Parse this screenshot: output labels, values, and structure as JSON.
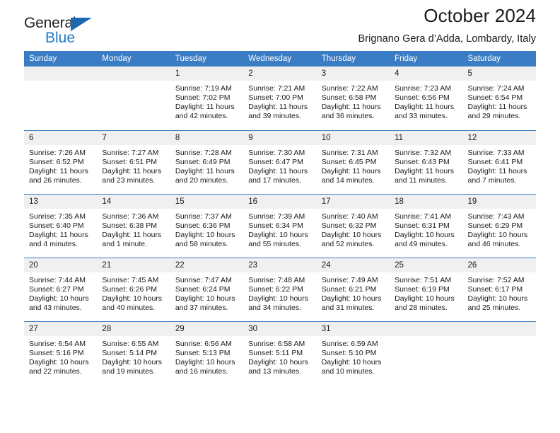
{
  "brand": {
    "name_part1": "General",
    "name_part2": "Blue"
  },
  "header": {
    "title": "October 2024",
    "subtitle": "Brignano Gera d’Adda, Lombardy, Italy"
  },
  "colors": {
    "header_blue": "#3b7dc4",
    "logo_blue": "#1e7ac8",
    "daynum_bg": "#f0f0f0",
    "text": "#1a1a1a"
  },
  "weekday_headers": [
    "Sunday",
    "Monday",
    "Tuesday",
    "Wednesday",
    "Thursday",
    "Friday",
    "Saturday"
  ],
  "weeks": [
    [
      {
        "day": "",
        "lines": []
      },
      {
        "day": "",
        "lines": []
      },
      {
        "day": "1",
        "lines": [
          "Sunrise: 7:19 AM",
          "Sunset: 7:02 PM",
          "Daylight: 11 hours",
          "and 42 minutes."
        ]
      },
      {
        "day": "2",
        "lines": [
          "Sunrise: 7:21 AM",
          "Sunset: 7:00 PM",
          "Daylight: 11 hours",
          "and 39 minutes."
        ]
      },
      {
        "day": "3",
        "lines": [
          "Sunrise: 7:22 AM",
          "Sunset: 6:58 PM",
          "Daylight: 11 hours",
          "and 36 minutes."
        ]
      },
      {
        "day": "4",
        "lines": [
          "Sunrise: 7:23 AM",
          "Sunset: 6:56 PM",
          "Daylight: 11 hours",
          "and 33 minutes."
        ]
      },
      {
        "day": "5",
        "lines": [
          "Sunrise: 7:24 AM",
          "Sunset: 6:54 PM",
          "Daylight: 11 hours",
          "and 29 minutes."
        ]
      }
    ],
    [
      {
        "day": "6",
        "lines": [
          "Sunrise: 7:26 AM",
          "Sunset: 6:52 PM",
          "Daylight: 11 hours",
          "and 26 minutes."
        ]
      },
      {
        "day": "7",
        "lines": [
          "Sunrise: 7:27 AM",
          "Sunset: 6:51 PM",
          "Daylight: 11 hours",
          "and 23 minutes."
        ]
      },
      {
        "day": "8",
        "lines": [
          "Sunrise: 7:28 AM",
          "Sunset: 6:49 PM",
          "Daylight: 11 hours",
          "and 20 minutes."
        ]
      },
      {
        "day": "9",
        "lines": [
          "Sunrise: 7:30 AM",
          "Sunset: 6:47 PM",
          "Daylight: 11 hours",
          "and 17 minutes."
        ]
      },
      {
        "day": "10",
        "lines": [
          "Sunrise: 7:31 AM",
          "Sunset: 6:45 PM",
          "Daylight: 11 hours",
          "and 14 minutes."
        ]
      },
      {
        "day": "11",
        "lines": [
          "Sunrise: 7:32 AM",
          "Sunset: 6:43 PM",
          "Daylight: 11 hours",
          "and 11 minutes."
        ]
      },
      {
        "day": "12",
        "lines": [
          "Sunrise: 7:33 AM",
          "Sunset: 6:41 PM",
          "Daylight: 11 hours",
          "and 7 minutes."
        ]
      }
    ],
    [
      {
        "day": "13",
        "lines": [
          "Sunrise: 7:35 AM",
          "Sunset: 6:40 PM",
          "Daylight: 11 hours",
          "and 4 minutes."
        ]
      },
      {
        "day": "14",
        "lines": [
          "Sunrise: 7:36 AM",
          "Sunset: 6:38 PM",
          "Daylight: 11 hours",
          "and 1 minute."
        ]
      },
      {
        "day": "15",
        "lines": [
          "Sunrise: 7:37 AM",
          "Sunset: 6:36 PM",
          "Daylight: 10 hours",
          "and 58 minutes."
        ]
      },
      {
        "day": "16",
        "lines": [
          "Sunrise: 7:39 AM",
          "Sunset: 6:34 PM",
          "Daylight: 10 hours",
          "and 55 minutes."
        ]
      },
      {
        "day": "17",
        "lines": [
          "Sunrise: 7:40 AM",
          "Sunset: 6:32 PM",
          "Daylight: 10 hours",
          "and 52 minutes."
        ]
      },
      {
        "day": "18",
        "lines": [
          "Sunrise: 7:41 AM",
          "Sunset: 6:31 PM",
          "Daylight: 10 hours",
          "and 49 minutes."
        ]
      },
      {
        "day": "19",
        "lines": [
          "Sunrise: 7:43 AM",
          "Sunset: 6:29 PM",
          "Daylight: 10 hours",
          "and 46 minutes."
        ]
      }
    ],
    [
      {
        "day": "20",
        "lines": [
          "Sunrise: 7:44 AM",
          "Sunset: 6:27 PM",
          "Daylight: 10 hours",
          "and 43 minutes."
        ]
      },
      {
        "day": "21",
        "lines": [
          "Sunrise: 7:45 AM",
          "Sunset: 6:26 PM",
          "Daylight: 10 hours",
          "and 40 minutes."
        ]
      },
      {
        "day": "22",
        "lines": [
          "Sunrise: 7:47 AM",
          "Sunset: 6:24 PM",
          "Daylight: 10 hours",
          "and 37 minutes."
        ]
      },
      {
        "day": "23",
        "lines": [
          "Sunrise: 7:48 AM",
          "Sunset: 6:22 PM",
          "Daylight: 10 hours",
          "and 34 minutes."
        ]
      },
      {
        "day": "24",
        "lines": [
          "Sunrise: 7:49 AM",
          "Sunset: 6:21 PM",
          "Daylight: 10 hours",
          "and 31 minutes."
        ]
      },
      {
        "day": "25",
        "lines": [
          "Sunrise: 7:51 AM",
          "Sunset: 6:19 PM",
          "Daylight: 10 hours",
          "and 28 minutes."
        ]
      },
      {
        "day": "26",
        "lines": [
          "Sunrise: 7:52 AM",
          "Sunset: 6:17 PM",
          "Daylight: 10 hours",
          "and 25 minutes."
        ]
      }
    ],
    [
      {
        "day": "27",
        "lines": [
          "Sunrise: 6:54 AM",
          "Sunset: 5:16 PM",
          "Daylight: 10 hours",
          "and 22 minutes."
        ]
      },
      {
        "day": "28",
        "lines": [
          "Sunrise: 6:55 AM",
          "Sunset: 5:14 PM",
          "Daylight: 10 hours",
          "and 19 minutes."
        ]
      },
      {
        "day": "29",
        "lines": [
          "Sunrise: 6:56 AM",
          "Sunset: 5:13 PM",
          "Daylight: 10 hours",
          "and 16 minutes."
        ]
      },
      {
        "day": "30",
        "lines": [
          "Sunrise: 6:58 AM",
          "Sunset: 5:11 PM",
          "Daylight: 10 hours",
          "and 13 minutes."
        ]
      },
      {
        "day": "31",
        "lines": [
          "Sunrise: 6:59 AM",
          "Sunset: 5:10 PM",
          "Daylight: 10 hours",
          "and 10 minutes."
        ]
      },
      {
        "day": "",
        "lines": []
      },
      {
        "day": "",
        "lines": []
      }
    ]
  ]
}
